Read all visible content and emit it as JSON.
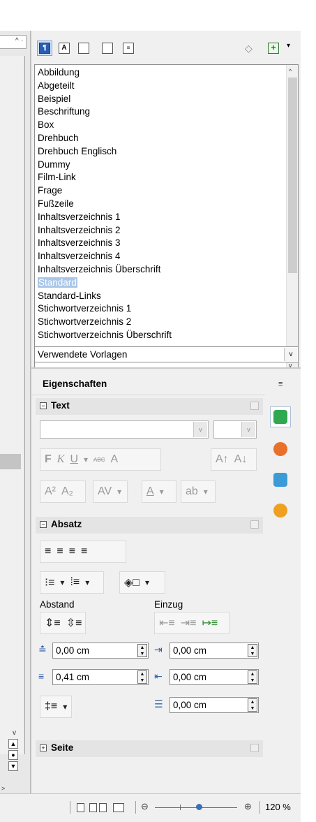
{
  "styles_panel": {
    "toolbar": {
      "family_icons": [
        "paragraph-styles-icon",
        "character-styles-icon",
        "frame-styles-icon",
        "page-styles-icon",
        "list-styles-icon"
      ],
      "family_labels": [
        "¶",
        "A",
        "",
        "",
        ""
      ],
      "active_family": "paragraph-styles",
      "fill_format_icon": "paint-bucket-icon",
      "new_style_icon": "new-style-from-selection-icon"
    },
    "styles": [
      "Abbildung",
      "Abgeteilt",
      "Beispiel",
      "Beschriftung",
      "Box",
      "Drehbuch",
      "Drehbuch Englisch",
      "Dummy",
      "Film-Link",
      "Frage",
      "Fußzeile",
      "Inhaltsverzeichnis 1",
      "Inhaltsverzeichnis 2",
      "Inhaltsverzeichnis 3",
      "Inhaltsverzeichnis 4",
      "Inhaltsverzeichnis Überschrift",
      "Standard",
      "Standard-Links",
      "Stichwortverzeichnis 1",
      "Stichwortverzeichnis 2",
      "Stichwortverzeichnis Überschrift"
    ],
    "selected_style": "Standard",
    "filter_value": "Verwendete Vorlagen"
  },
  "properties": {
    "title": "Eigenschaften",
    "text_panel": {
      "title": "Text",
      "font_name": "",
      "font_size": "",
      "format_labels": {
        "bold": "F",
        "italic": "K",
        "underline": "U",
        "strikethrough": "ABC",
        "shadow": "A"
      }
    },
    "paragraph_panel": {
      "title": "Absatz",
      "spacing_label": "Abstand",
      "indent_label": "Einzug",
      "above_spacing": "0,00 cm",
      "below_spacing": "0,41 cm",
      "before_indent": "0,00 cm",
      "after_indent": "0,00 cm",
      "first_line_indent": "0,00 cm"
    },
    "page_panel": {
      "title": "Seite"
    }
  },
  "tabbar": {
    "tabs": [
      "properties-tab",
      "gallery-tab",
      "navigator-tab",
      "functions-tab"
    ],
    "active_tab": "properties-tab",
    "colors": [
      "#2fa84f",
      "#e8702a",
      "#3c9bd6",
      "#f0a020"
    ]
  },
  "statusbar": {
    "zoom_level": "120 %",
    "zoom_value": 120
  }
}
